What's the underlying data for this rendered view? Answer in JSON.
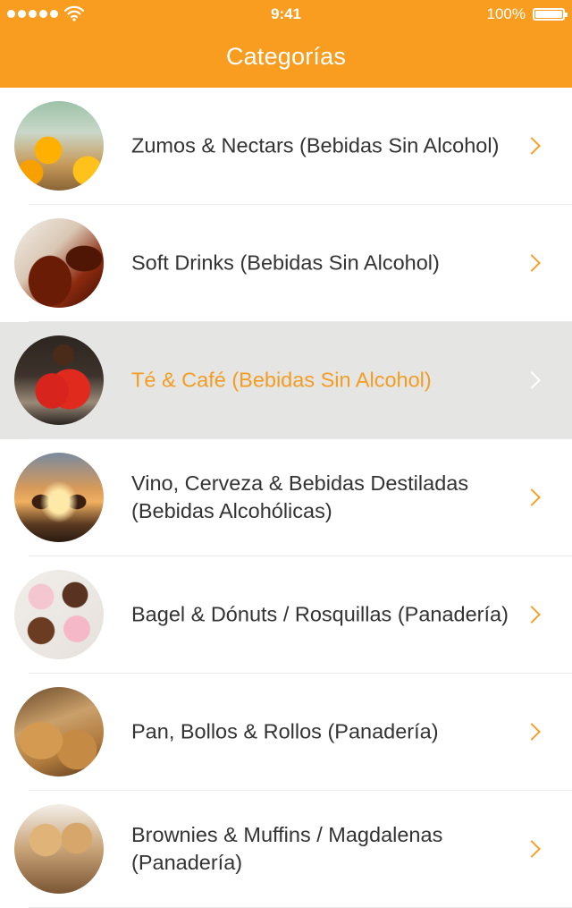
{
  "status_bar": {
    "time": "9:41",
    "battery_percent": "100%",
    "battery_level": 1.0,
    "signal_icon": "signal-dots-icon",
    "wifi_icon": "wifi-icon",
    "battery_icon": "battery-icon"
  },
  "header": {
    "title": "Categorías",
    "background_color": "#f89d1f"
  },
  "categories": [
    {
      "label": "Zumos & Nectars (Bebidas Sin Alcohol)",
      "thumbnail": "orange-juice-image",
      "selected": false
    },
    {
      "label": "Soft Drinks (Bebidas Sin Alcohol)",
      "thumbnail": "soft-drink-image",
      "selected": false
    },
    {
      "label": "Té & Café (Bebidas Sin Alcohol)",
      "thumbnail": "coffee-cups-image",
      "selected": true
    },
    {
      "label": "Vino, Cerveza & Bebidas Destiladas (Bebidas Alcohólicas)",
      "thumbnail": "beer-bottles-image",
      "selected": false
    },
    {
      "label": "Bagel & Dónuts / Rosquillas (Panadería)",
      "thumbnail": "donuts-image",
      "selected": false
    },
    {
      "label": "Pan, Bollos & Rollos (Panadería)",
      "thumbnail": "bread-image",
      "selected": false
    },
    {
      "label": "Brownies & Muffins / Magdalenas (Panadería)",
      "thumbnail": "muffins-image",
      "selected": false
    }
  ],
  "colors": {
    "accent": "#f39c23",
    "selected_row": "#e5e6e3",
    "text": "#333333"
  }
}
